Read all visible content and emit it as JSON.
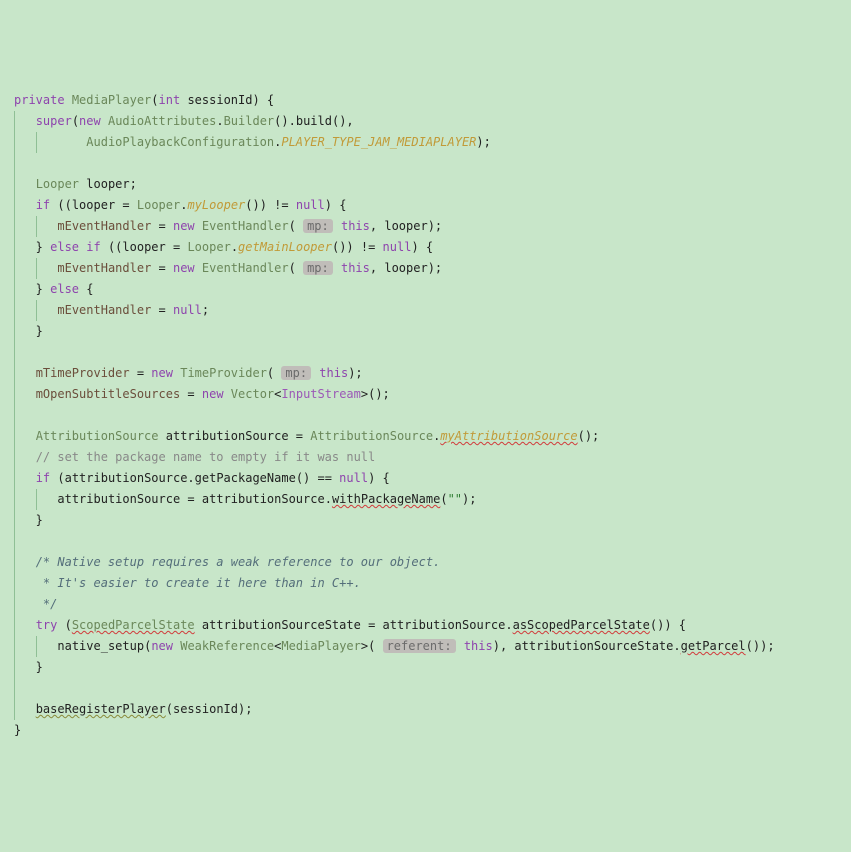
{
  "line1": {
    "kw_private": "private",
    "cls": "MediaPlayer",
    "kw_int": "int",
    "param": "sessionId",
    "brace": ") {"
  },
  "line2": {
    "super": "super",
    "kw_new": "new",
    "cls": "AudioAttributes",
    "builder": "Builder",
    "build": "build"
  },
  "line3": {
    "cls": "AudioPlaybackConfiguration",
    "const": "PLAYER_TYPE_JAM_MEDIAPLAYER"
  },
  "line5": {
    "cls": "Looper",
    "var": "looper"
  },
  "line6": {
    "kw_if": "if",
    "var": "looper",
    "cls": "Looper",
    "method": "myLooper",
    "kw_null": "null"
  },
  "line7": {
    "field": "mEventHandler",
    "kw_new": "new",
    "cls": "EventHandler",
    "hint": "mp:",
    "kw_this": "this",
    "var": "looper"
  },
  "line8": {
    "kw_else": "else",
    "kw_if": "if",
    "var": "looper",
    "cls": "Looper",
    "method": "getMainLooper",
    "kw_null": "null"
  },
  "line9": {
    "field": "mEventHandler",
    "kw_new": "new",
    "cls": "EventHandler",
    "hint": "mp:",
    "kw_this": "this",
    "var": "looper"
  },
  "line10": {
    "kw_else": "else"
  },
  "line11": {
    "field": "mEventHandler",
    "kw_null": "null"
  },
  "line14": {
    "field": "mTimeProvider",
    "kw_new": "new",
    "cls": "TimeProvider",
    "hint": "mp:",
    "kw_this": "this"
  },
  "line15": {
    "field": "mOpenSubtitleSources",
    "kw_new": "new",
    "cls": "Vector",
    "gen": "InputStream"
  },
  "line17": {
    "cls": "AttributionSource",
    "var": "attributionSource",
    "method": "myAttributionSource"
  },
  "line18": {
    "comment": "// set the package name to empty if it was null"
  },
  "line19": {
    "kw_if": "if",
    "var": "attributionSource",
    "method": "getPackageName",
    "kw_null": "null"
  },
  "line20": {
    "var": "attributionSource",
    "method": "withPackageName",
    "str": "\"\""
  },
  "line23": {
    "c1": "/* Native setup requires a weak reference to our object."
  },
  "line24": {
    "c2": " * It's easier to create it here than in C++."
  },
  "line25": {
    "c3": " */"
  },
  "line26": {
    "kw_try": "try",
    "cls": "ScopedParcelState",
    "var": "attributionSourceState",
    "var2": "attributionSource",
    "method": "asScopedParcelState"
  },
  "line27": {
    "fn": "native_setup",
    "kw_new": "new",
    "cls": "WeakReference",
    "gen": "MediaPlayer",
    "hint": "referent:",
    "kw_this": "this",
    "var": "attributionSourceState",
    "method": "getParcel"
  },
  "line30": {
    "fn": "baseRegisterPlayer",
    "var": "sessionId"
  }
}
